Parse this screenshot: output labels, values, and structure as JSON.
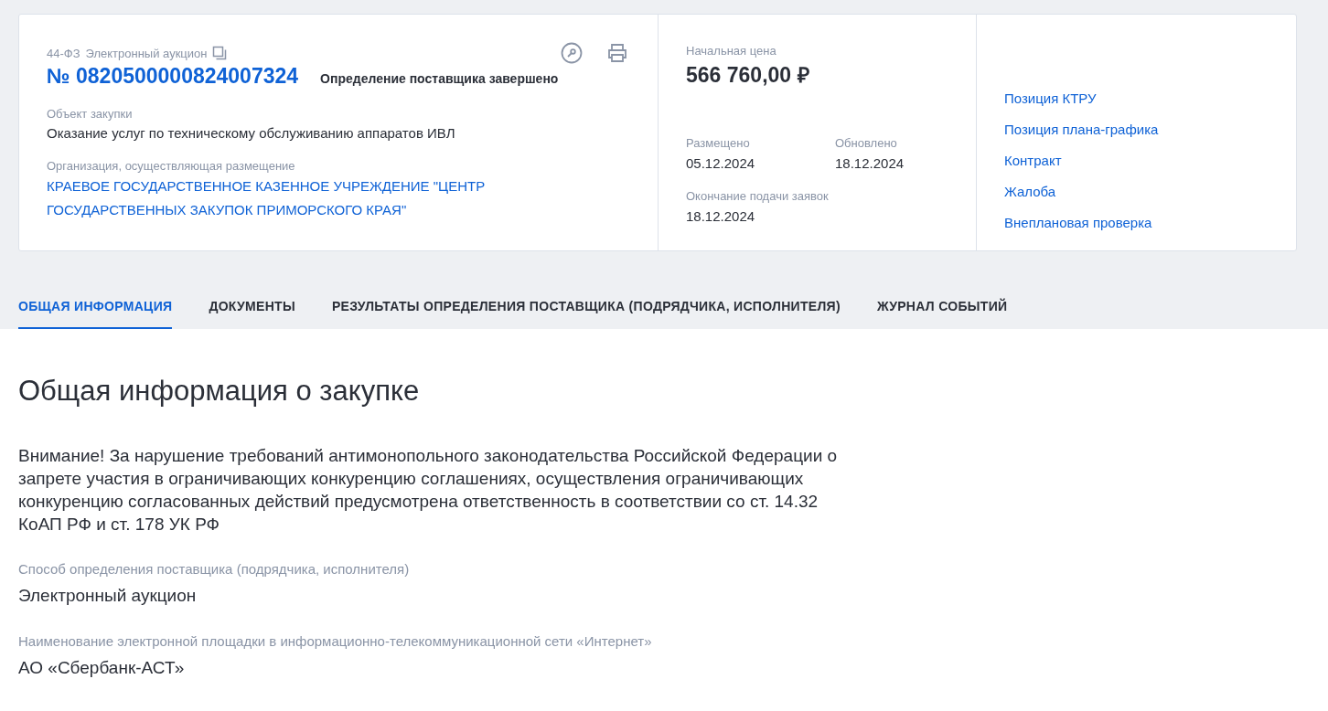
{
  "purchase": {
    "law": "44-ФЗ",
    "method": "Электронный аукцион",
    "number": "№ 0820500000824007324",
    "status": "Определение поставщика завершено",
    "object_label": "Объект закупки",
    "object": "Оказание услуг по техническому обслуживанию аппаратов ИВЛ",
    "org_label": "Организация, осуществляющая размещение",
    "org": "КРАЕВОЕ ГОСУДАРСТВЕННОЕ КАЗЕННОЕ УЧРЕЖДЕНИЕ \"ЦЕНТР ГОСУДАРСТВЕННЫХ ЗАКУПОК ПРИМОРСКОГО КРАЯ\""
  },
  "price": {
    "label": "Начальная цена",
    "value": "566 760,00 ₽",
    "dates": [
      {
        "label": "Размещено",
        "value": "05.12.2024"
      },
      {
        "label": "Обновлено",
        "value": "18.12.2024"
      },
      {
        "label": "Окончание подачи заявок",
        "value": "18.12.2024"
      }
    ]
  },
  "links": [
    "Позиция КТРУ",
    "Позиция плана-графика",
    "Контракт",
    "Жалоба",
    "Внеплановая проверка"
  ],
  "tabs": [
    {
      "label": "ОБЩАЯ ИНФОРМАЦИЯ",
      "selected": true
    },
    {
      "label": "ДОКУМЕНТЫ",
      "selected": false
    },
    {
      "label": "РЕЗУЛЬТАТЫ ОПРЕДЕЛЕНИЯ ПОСТАВЩИКА (ПОДРЯДЧИКА, ИСПОЛНИТЕЛЯ)",
      "selected": false
    },
    {
      "label": "ЖУРНАЛ СОБЫТИЙ",
      "selected": false
    }
  ],
  "section": {
    "title": "Общая информация о закупке",
    "warning": "Внимание! За нарушение требований антимонопольного законодательства Российской Федерации о запрете участия в ограничивающих конкуренцию соглашениях, осуществления ограничивающих конкуренцию согласованных действий предусмотрена ответственность в соответствии со ст. 14.32 КоАП РФ и ст. 178 УК РФ",
    "fields": [
      {
        "label": "Способ определения поставщика (подрядчика, исполнителя)",
        "value": "Электронный аукцион"
      },
      {
        "label": "Наименование электронной площадки в информационно-телекоммуникационной сети «Интернет»",
        "value": "АО «Сбербанк-АСТ»"
      }
    ]
  }
}
